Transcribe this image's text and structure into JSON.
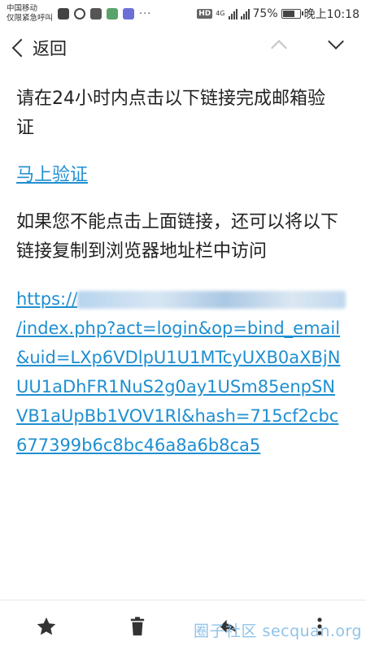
{
  "status_bar": {
    "carrier_line1": "中国移动",
    "carrier_line2": "仅限紧急呼叫",
    "dots": "···",
    "hd": "HD",
    "network": "4G",
    "battery_text": "75%",
    "battery_level": 0.75,
    "time": "晚上10:18"
  },
  "nav": {
    "back_label": "返回"
  },
  "message": {
    "intro": "请在24小时内点击以下链接完成邮箱验证",
    "verify_link": "马上验证",
    "instruction": "如果您不能点击上面链接，还可以将以下链接复制到浏览器地址栏中访问",
    "url_prefix": "https://",
    "url_rest": "/index.php?act=login&op=bind_email&uid=LXp6VDlpU1U1MTcyUXB0aXBjNUU1aDhFR1NuS2g0ay1USm85enpSNVB1aUpBb1VOV1Rl&hash=715cf2cbc677399b6c8bc46a8a6b8ca5"
  },
  "toolbar": {
    "star": "star-icon",
    "delete": "trash-icon",
    "reply": "reply-icon",
    "more": "more-vertical-icon"
  },
  "watermark": "圈子社区 secquan.org",
  "colors": {
    "link": "#1f8fd1",
    "text": "#222222",
    "watermark": "#8fc3e8"
  }
}
